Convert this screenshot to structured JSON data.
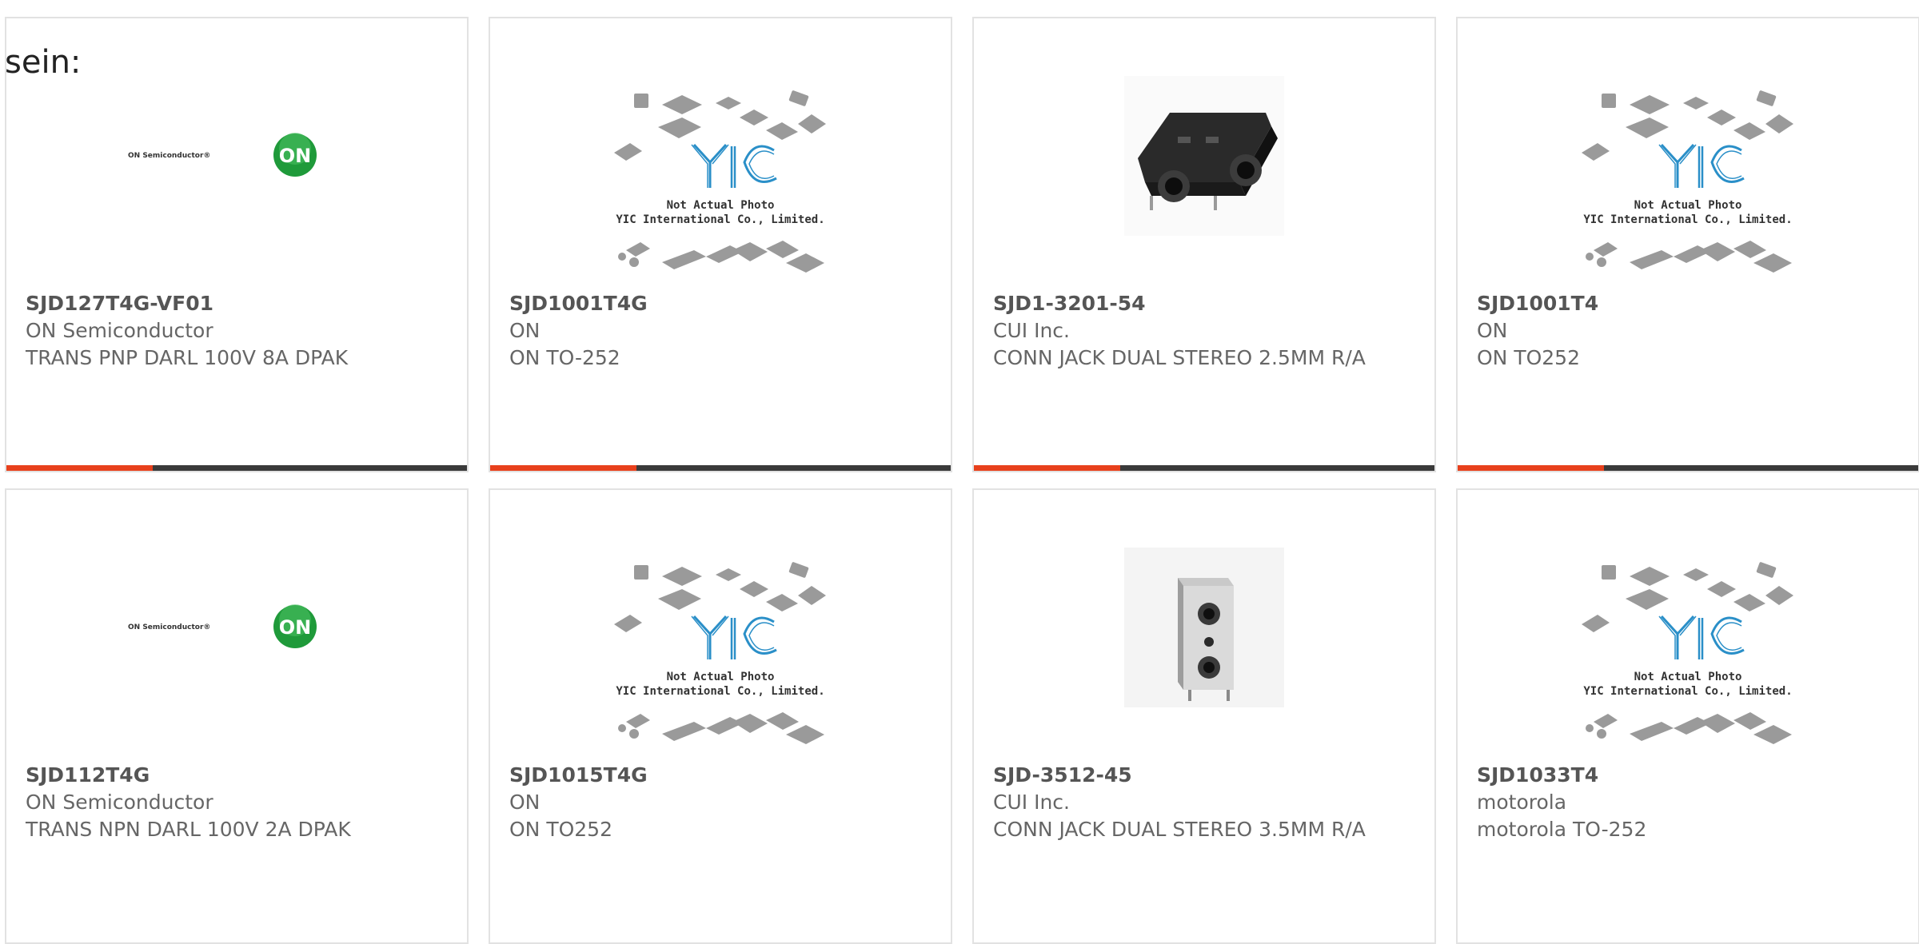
{
  "fragment_text": "sein:",
  "colors": {
    "accent": "#e8401c",
    "bar_dark": "#3a3a3a",
    "card_border": "#e2e2e2",
    "text_gray": "#666666",
    "yic_blue": "#2a8fc8",
    "on_green": "#1f9a3a"
  },
  "products": [
    {
      "part": "SJD127T4G-VF01",
      "maker": "ON Semiconductor",
      "desc": "TRANS PNP DARL 100V 8A DPAK",
      "image": "on-semiconductor-logo",
      "logo_text": "ON Semiconductor®",
      "logo_badge": "ON"
    },
    {
      "part": "SJD1001T4G",
      "maker": "ON",
      "desc": "ON TO-252",
      "image": "yic-placeholder",
      "placeholder_line1": "Not Actual Photo",
      "placeholder_line2": "YIC International Co., Limited."
    },
    {
      "part": "SJD1-3201-54",
      "maker": "CUI Inc.",
      "desc": "CONN JACK DUAL STEREO 2.5MM R/A",
      "image": "audio-jack-photo"
    },
    {
      "part": "SJD1001T4",
      "maker": "ON",
      "desc": "ON TO252",
      "image": "yic-placeholder",
      "placeholder_line1": "Not Actual Photo",
      "placeholder_line2": "YIC International Co., Limited."
    },
    {
      "part": "SJD112T4G",
      "maker": "ON Semiconductor",
      "desc": "TRANS NPN DARL 100V 2A DPAK",
      "image": "on-semiconductor-logo",
      "logo_text": "ON Semiconductor®",
      "logo_badge": "ON"
    },
    {
      "part": "SJD1015T4G",
      "maker": "ON",
      "desc": "ON TO252",
      "image": "yic-placeholder",
      "placeholder_line1": "Not Actual Photo",
      "placeholder_line2": "YIC International Co., Limited."
    },
    {
      "part": "SJD-3512-45",
      "maker": "CUI Inc.",
      "desc": "CONN JACK DUAL STEREO 3.5MM R/A",
      "image": "vertical-jack-photo"
    },
    {
      "part": "SJD1033T4",
      "maker": "motorola",
      "desc": "motorola TO-252",
      "image": "yic-placeholder",
      "placeholder_line1": "Not Actual Photo",
      "placeholder_line2": "YIC International Co., Limited."
    }
  ]
}
